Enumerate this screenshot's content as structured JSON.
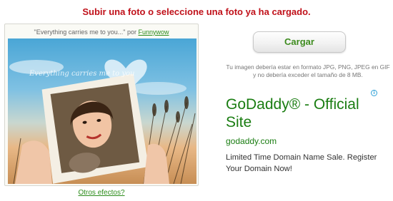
{
  "header": {
    "instruction": "Subir una foto o seleccione una foto ya ha cargado."
  },
  "effect_card": {
    "caption_quote": "\"Everything carries me to you...\" por",
    "author_link": "Funnywow",
    "photo_overlay_text": "Everything carries me to you",
    "more_effects_link": "Otros efectos?"
  },
  "upload": {
    "button_label": "Cargar",
    "hint": "Tu imagen debería estar en formato JPG, PNG, JPEG en GIF y no debería exceder el tamaño de 8 MB."
  },
  "ad": {
    "title": "GoDaddy® - Official Site",
    "url": "godaddy.com",
    "description": "Limited Time Domain Name Sale. Register Your Domain Now!",
    "choice_icon": "adchoices-icon"
  },
  "colors": {
    "headline": "#c0111a",
    "accent_green": "#1a7d12",
    "link_green": "#2c8c1b"
  }
}
